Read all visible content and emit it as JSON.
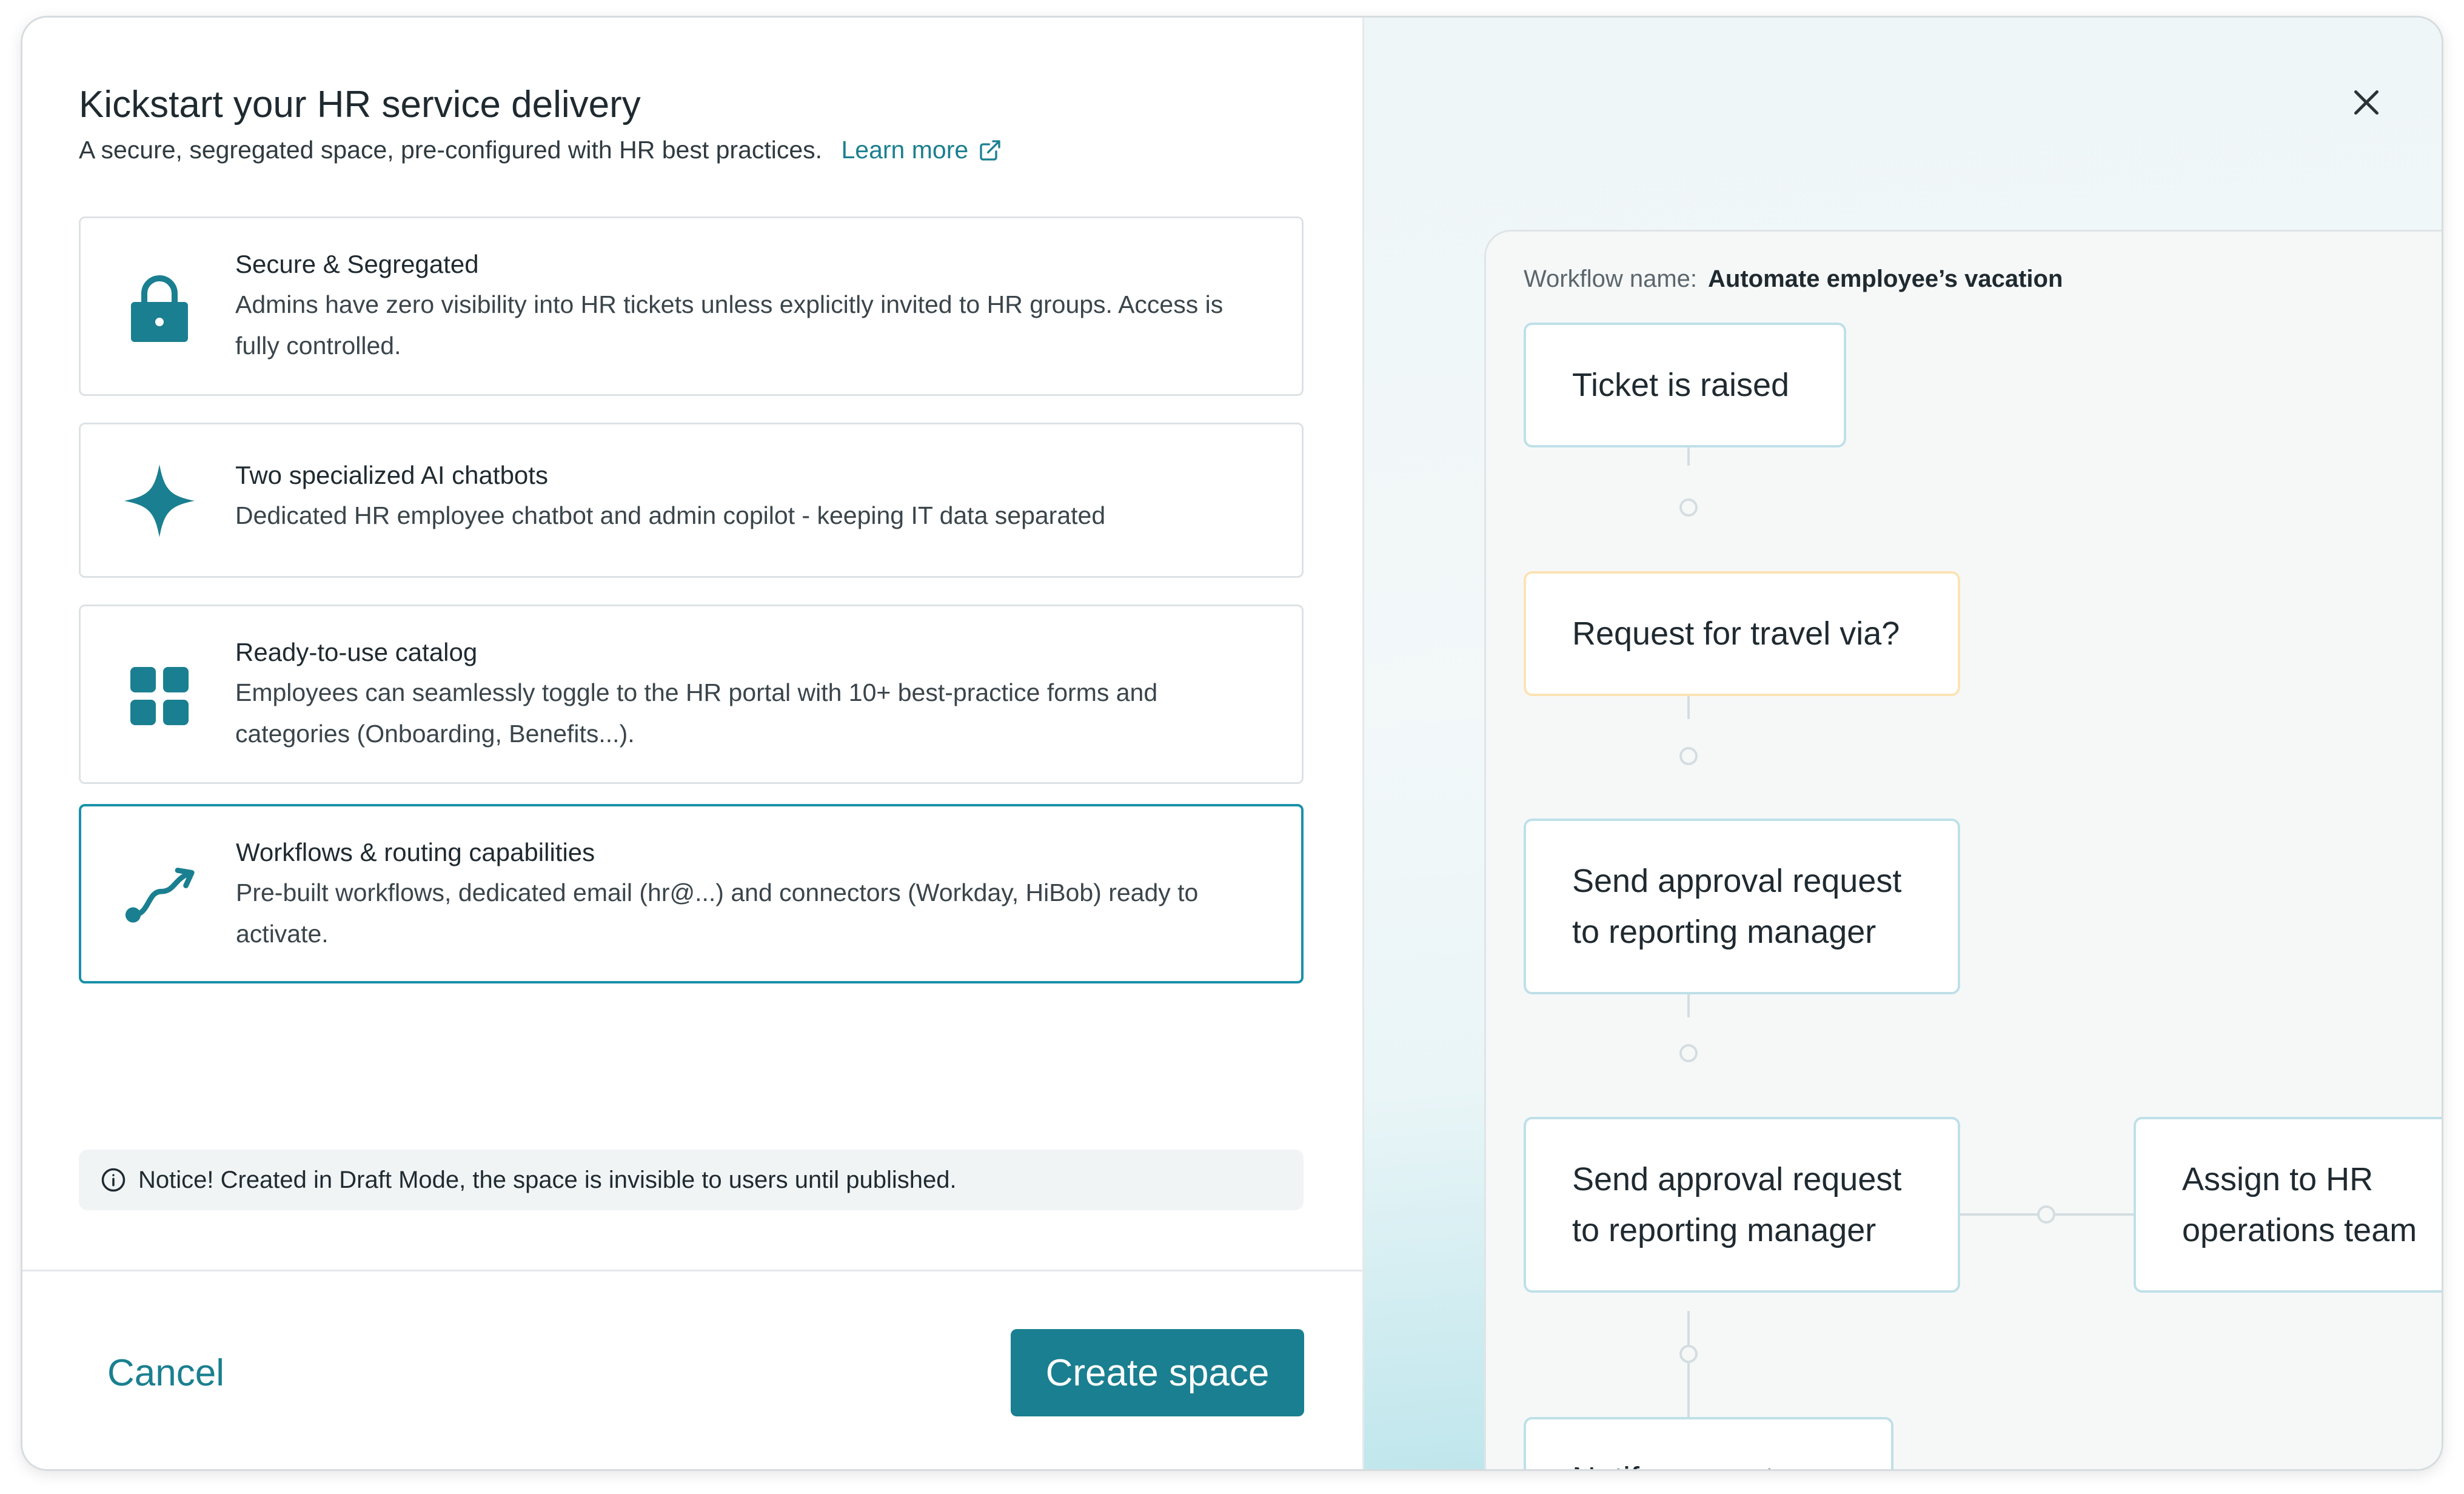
{
  "header": {
    "title": "Kickstart your HR service delivery",
    "subtitle": "A secure, segregated space, pre-configured with HR best practices.",
    "learn_more": "Learn more"
  },
  "features": [
    {
      "title": "Secure & Segregated",
      "description": "Admins have zero visibility into HR tickets unless explicitly invited to HR groups. Access is fully controlled.",
      "icon": "lock-icon"
    },
    {
      "title": "Two specialized AI chatbots",
      "description": "Dedicated HR employee chatbot and admin copilot - keeping IT data separated",
      "icon": "sparkle-icon"
    },
    {
      "title": "Ready-to-use catalog",
      "description": "Employees can seamlessly toggle to the HR portal with 10+ best-practice forms and categories (Onboarding, Benefits...).",
      "icon": "grid-icon"
    },
    {
      "title": "Workflows & routing capabilities",
      "description": "Pre-built workflows, dedicated email (hr@...) and connectors (Workday, HiBob) ready to activate.",
      "icon": "route-icon"
    }
  ],
  "notice": "Notice! Created in Draft Mode, the space is invisible to users until published.",
  "footer": {
    "cancel": "Cancel",
    "create": "Create space"
  },
  "workflow": {
    "label": "Workflow name:",
    "name": "Automate employee’s vacation",
    "nodes": [
      "Ticket is raised",
      "Request for travel via?",
      "Send approval request to reporting manager",
      "Send approval request to reporting manager",
      "Assign to HR operations team",
      "Notify requester"
    ]
  },
  "colors": {
    "accent": "#1a7f90",
    "selected_border": "#1a91a8",
    "condition_border": "#fbe3b5",
    "node_border": "#bfe0e8"
  }
}
